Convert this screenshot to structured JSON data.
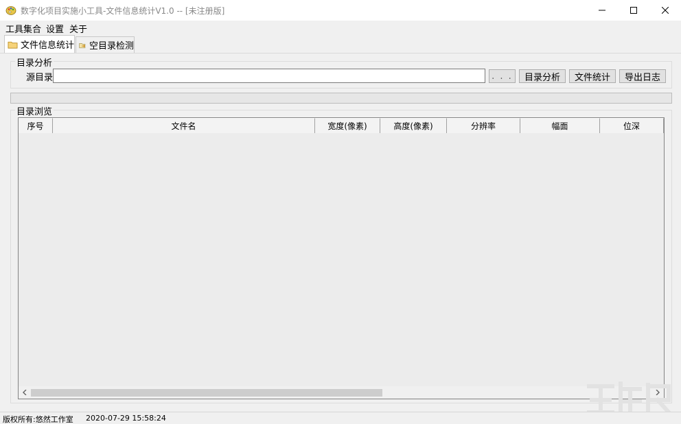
{
  "window": {
    "title": "数字化项目实施小工具-文件信息统计V1.0 -- [未注册版]",
    "minimize_icon": "minimize-icon",
    "maximize_icon": "maximize-icon",
    "close_icon": "close-icon"
  },
  "menu": {
    "items": [
      "工具集合",
      "设置",
      "关于"
    ]
  },
  "tabs": [
    {
      "label": "文件信息统计",
      "icon": "folder-icon",
      "active": true
    },
    {
      "label": "空目录检测",
      "icon": "empty-folder-check-icon",
      "active": false
    }
  ],
  "analysis": {
    "group_title": "目录分析",
    "source_label": "源目录",
    "source_value": "",
    "browse_label": ". . .",
    "analyze_label": "目录分析",
    "stats_label": "文件统计",
    "export_label": "导出日志"
  },
  "progress": {
    "value": 0
  },
  "browse": {
    "group_title": "目录浏览",
    "columns": [
      "序号",
      "文件名",
      "宽度(像素)",
      "高度(像素)",
      "分辨率",
      "幅面",
      "位深"
    ],
    "rows": []
  },
  "status": {
    "copyright": "版权所有:悠然工作室",
    "datetime": "2020-07-29 15:58:24"
  },
  "colors": {
    "window_bg": "#f0f0f0",
    "titlebar_bg": "#ffffff",
    "title_text": "#888888",
    "button_bg": "#e1e1e1",
    "grid_bg": "#ececec"
  }
}
